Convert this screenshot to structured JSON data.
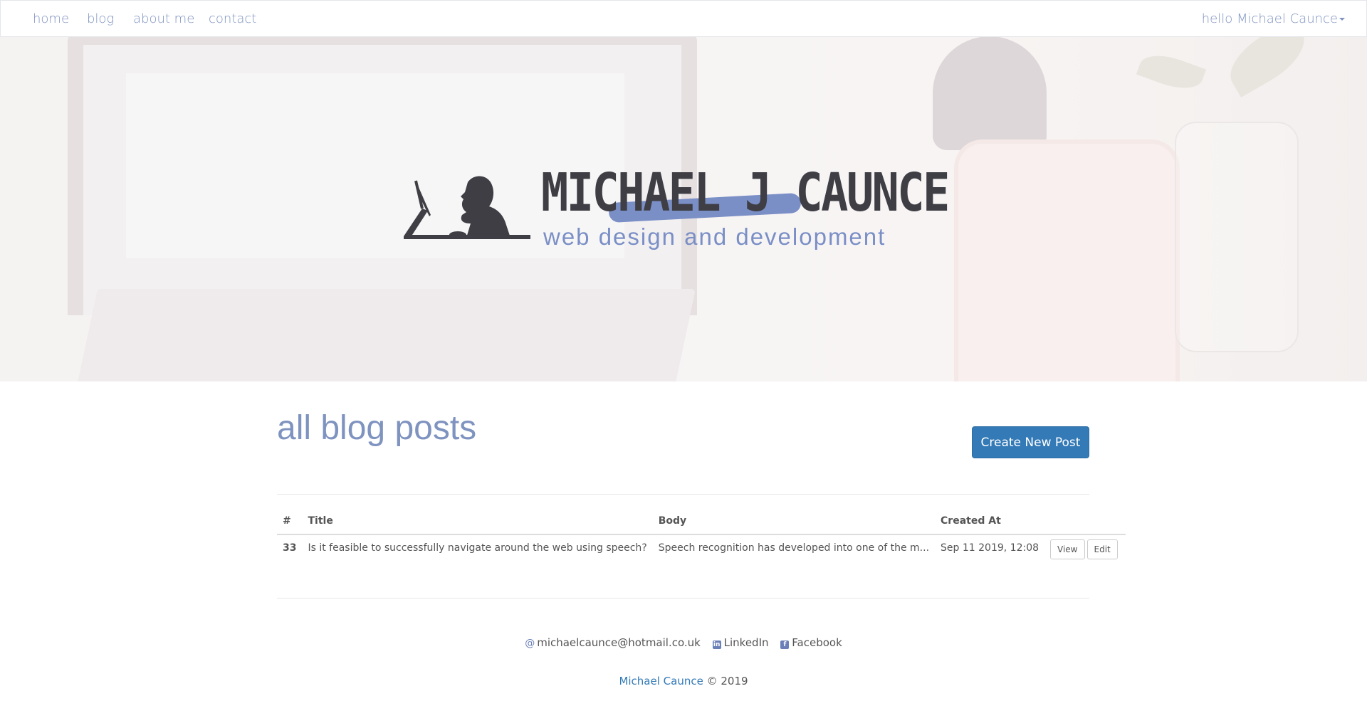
{
  "nav": {
    "items": [
      {
        "label": "home"
      },
      {
        "label": "blog"
      },
      {
        "label": "about me"
      },
      {
        "label": "contact"
      }
    ],
    "user_menu": "hello Michael Caunce"
  },
  "hero": {
    "logo_title": "MICHAEL J CAUNCE",
    "logo_subtitle": "web design and development"
  },
  "main": {
    "title": "all blog posts",
    "create_button": "Create New Post",
    "table": {
      "headers": [
        "#",
        "Title",
        "Body",
        "Created At"
      ],
      "rows": [
        {
          "id": "33",
          "title": "Is it feasible to successfully navigate around the web using speech?",
          "body": "Speech recognition has developed into one of the m...",
          "created": "Sep 11 2019, 12:08",
          "view_label": "View",
          "edit_label": "Edit"
        }
      ]
    }
  },
  "footer": {
    "email": "michaelcaunce@hotmail.co.uk",
    "linkedin": "LinkedIn",
    "facebook": "Facebook",
    "author": "Michael Caunce",
    "copyright": "© 2019"
  },
  "colors": {
    "accent": "#7f93c0",
    "primary_button": "#337ab7"
  }
}
